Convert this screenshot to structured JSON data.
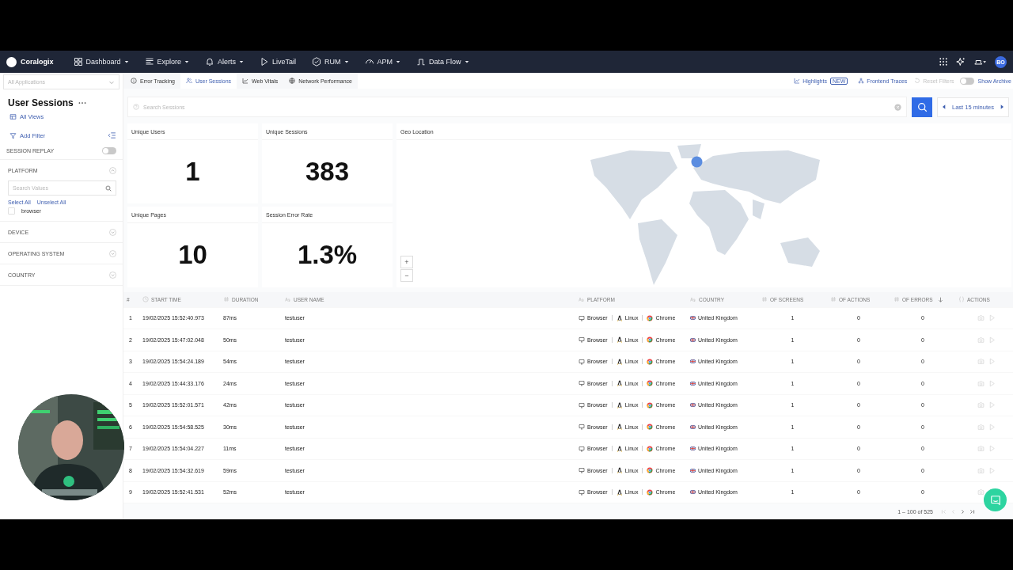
{
  "nav": {
    "brand": "Coralogix",
    "avatar": "BO",
    "items": [
      {
        "label": "Dashboard",
        "dropdown": true
      },
      {
        "label": "Explore",
        "dropdown": true
      },
      {
        "label": "Alerts",
        "dropdown": true
      },
      {
        "label": "LiveTail",
        "dropdown": false
      },
      {
        "label": "RUM",
        "dropdown": true
      },
      {
        "label": "APM",
        "dropdown": true
      },
      {
        "label": "Data Flow",
        "dropdown": true
      }
    ]
  },
  "app_select": {
    "placeholder": "All Applications"
  },
  "tabs": [
    {
      "label": "Error Tracking",
      "selected": false
    },
    {
      "label": "User Sessions",
      "selected": true
    },
    {
      "label": "Web Vitals",
      "selected": false
    },
    {
      "label": "Network Performance",
      "selected": false
    }
  ],
  "toolbar": {
    "highlights": "Highlights",
    "badge": "NEW",
    "frontend_traces": "Frontend Traces",
    "reset_filters": {
      "label": "Reset Filters",
      "disabled": true
    },
    "show_archive": {
      "label": "Show Archive",
      "on": false
    }
  },
  "sidebar": {
    "title": "User Sessions",
    "all_views": "All Views",
    "add_filter": "Add Filter",
    "session_replay": {
      "label": "SESSION REPLAY",
      "on": false
    },
    "filters": [
      {
        "label": "PLATFORM",
        "expanded": true,
        "search_placeholder": "Search Values",
        "select_all": "Select All",
        "unselect_all": "Unselect All",
        "values": [
          {
            "label": "browser",
            "checked": false
          }
        ]
      },
      {
        "label": "DEVICE",
        "expanded": false
      },
      {
        "label": "OPERATING SYSTEM",
        "expanded": false
      },
      {
        "label": "COUNTRY",
        "expanded": false
      }
    ]
  },
  "search": {
    "placeholder": "Search Sessions"
  },
  "time_range": "Last 15 minutes",
  "stats": [
    {
      "label": "Unique Users",
      "value": "1"
    },
    {
      "label": "Unique Sessions",
      "value": "383"
    },
    {
      "label": "Unique Pages",
      "value": "10"
    },
    {
      "label": "Session Error Rate",
      "value": "1.3%"
    }
  ],
  "geo": {
    "title": "Geo Location",
    "zoom_in": "+",
    "zoom_out": "−"
  },
  "table": {
    "columns": [
      {
        "label": "#",
        "sorted": false
      },
      {
        "label": "START TIME",
        "sorted": false
      },
      {
        "label": "DURATION",
        "sorted": false
      },
      {
        "label": "USER NAME",
        "sorted": false
      },
      {
        "label": "PLATFORM",
        "sorted": false
      },
      {
        "label": "COUNTRY",
        "sorted": false
      },
      {
        "label": "OF SCREENS",
        "sorted": false
      },
      {
        "label": "OF ACTIONS",
        "sorted": false
      },
      {
        "label": "OF ERRORS",
        "sorted": true
      },
      {
        "label": "ACTIONS",
        "sorted": false
      }
    ],
    "rows": [
      {
        "index": "1",
        "start": "19/02/2025 15:52:40.973",
        "duration": "87ms",
        "user": "testuser",
        "device": "Browser",
        "os": "Linux",
        "browser": "Chrome",
        "country": "United Kingdom",
        "screens": "1",
        "actions": "0",
        "errors": "0"
      },
      {
        "index": "2",
        "start": "19/02/2025 15:47:02.048",
        "duration": "50ms",
        "user": "testuser",
        "device": "Browser",
        "os": "Linux",
        "browser": "Chrome",
        "country": "United Kingdom",
        "screens": "1",
        "actions": "0",
        "errors": "0"
      },
      {
        "index": "3",
        "start": "19/02/2025 15:54:24.189",
        "duration": "54ms",
        "user": "testuser",
        "device": "Browser",
        "os": "Linux",
        "browser": "Chrome",
        "country": "United Kingdom",
        "screens": "1",
        "actions": "0",
        "errors": "0"
      },
      {
        "index": "4",
        "start": "19/02/2025 15:44:33.176",
        "duration": "24ms",
        "user": "testuser",
        "device": "Browser",
        "os": "Linux",
        "browser": "Chrome",
        "country": "United Kingdom",
        "screens": "1",
        "actions": "0",
        "errors": "0"
      },
      {
        "index": "5",
        "start": "19/02/2025 15:52:01.571",
        "duration": "42ms",
        "user": "testuser",
        "device": "Browser",
        "os": "Linux",
        "browser": "Chrome",
        "country": "United Kingdom",
        "screens": "1",
        "actions": "0",
        "errors": "0"
      },
      {
        "index": "6",
        "start": "19/02/2025 15:54:58.525",
        "duration": "30ms",
        "user": "testuser",
        "device": "Browser",
        "os": "Linux",
        "browser": "Chrome",
        "country": "United Kingdom",
        "screens": "1",
        "actions": "0",
        "errors": "0"
      },
      {
        "index": "7",
        "start": "19/02/2025 15:54:04.227",
        "duration": "11ms",
        "user": "testuser",
        "device": "Browser",
        "os": "Linux",
        "browser": "Chrome",
        "country": "United Kingdom",
        "screens": "1",
        "actions": "0",
        "errors": "0"
      },
      {
        "index": "8",
        "start": "19/02/2025 15:54:32.619",
        "duration": "59ms",
        "user": "testuser",
        "device": "Browser",
        "os": "Linux",
        "browser": "Chrome",
        "country": "United Kingdom",
        "screens": "1",
        "actions": "0",
        "errors": "0"
      },
      {
        "index": "9",
        "start": "19/02/2025 15:52:41.531",
        "duration": "52ms",
        "user": "testuser",
        "device": "Browser",
        "os": "Linux",
        "browser": "Chrome",
        "country": "United Kingdom",
        "screens": "1",
        "actions": "0",
        "errors": "0"
      }
    ],
    "pagination": "1 – 100 of 525"
  }
}
